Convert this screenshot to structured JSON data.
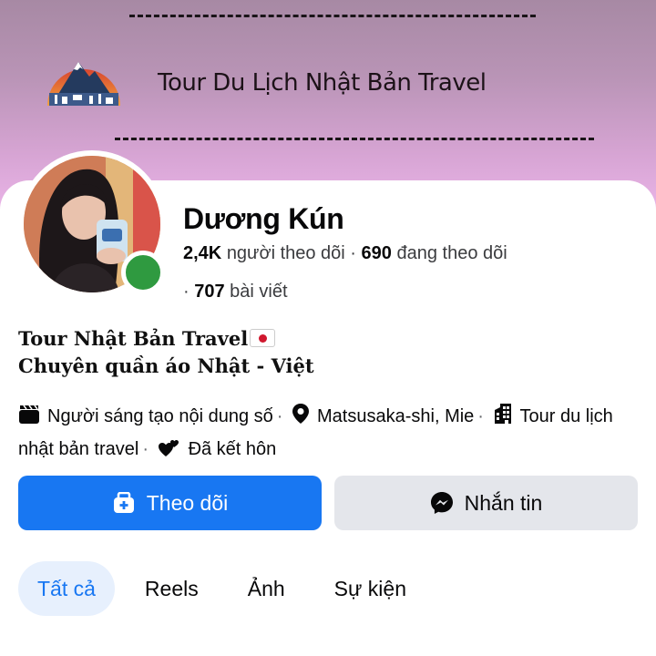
{
  "cover": {
    "title": "Tour Du Lịch Nhật Bản Travel",
    "logo_icon": "mountain-logo-icon"
  },
  "profile": {
    "name": "Dương Kún",
    "followers_count": "2,4K",
    "followers_label": "người theo dõi",
    "following_count": "690",
    "following_label": "đang theo dõi",
    "posts_count": "707",
    "posts_label": "bài viết",
    "online": true
  },
  "bio": {
    "line1": "Tour Nhật Bản Travel",
    "line2": "Chuyên quần áo Nhật - Việt"
  },
  "details": {
    "creator": "Người sáng tạo nội dung số",
    "location": "Matsusaka-shi, Mie",
    "workplace": "Tour du lịch nhật bản travel",
    "relationship": "Đã kết hôn",
    "separator": "·"
  },
  "actions": {
    "follow_label": "Theo dõi",
    "message_label": "Nhắn tin"
  },
  "tabs": [
    {
      "label": "Tất cả",
      "active": true
    },
    {
      "label": "Reels",
      "active": false
    },
    {
      "label": "Ảnh",
      "active": false
    },
    {
      "label": "Sự kiện",
      "active": false
    }
  ],
  "colors": {
    "accent": "#1877f2",
    "online": "#2f9a40",
    "secondary_button": "#e4e6eb"
  }
}
